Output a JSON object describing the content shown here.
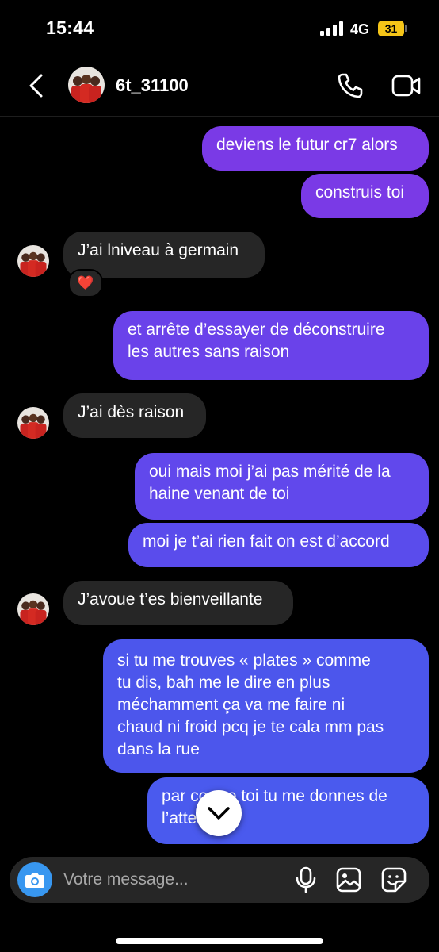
{
  "status_bar": {
    "time": "15:44",
    "network": "4G",
    "battery": "31"
  },
  "header": {
    "username": "6t_31100"
  },
  "messages": [
    {
      "side": "sent",
      "lines": [
        "deviens le futur cr7 alors"
      ]
    },
    {
      "side": "sent",
      "lines": [
        "construis toi"
      ]
    },
    {
      "side": "received",
      "lines": [
        "J’ai lniveau à germain"
      ],
      "reaction": "❤️"
    },
    {
      "side": "sent",
      "lines": [
        "et arrête d’essayer de déconstruire",
        "les autres sans raison"
      ]
    },
    {
      "side": "received",
      "lines": [
        "J’ai dès raison"
      ]
    },
    {
      "side": "sent",
      "lines": [
        "oui mais moi j’ai pas mérité de la",
        "haine venant de toi"
      ]
    },
    {
      "side": "sent",
      "lines": [
        "moi je t’ai rien fait on est d’accord"
      ]
    },
    {
      "side": "received",
      "lines": [
        "J’avoue t’es bienveillante"
      ]
    },
    {
      "side": "sent",
      "lines": [
        "si tu me trouves « plates » comme",
        "tu dis, bah me le dire en plus",
        "méchamment ça va me faire ni",
        "chaud ni froid pcq je te cala mm pas",
        "dans la rue"
      ]
    },
    {
      "side": "sent",
      "lines": [
        "par contre toi tu me donnes de",
        "l’attention"
      ]
    }
  ],
  "composer": {
    "placeholder": "Votre message..."
  },
  "colors": {
    "background": "#000000",
    "received_bubble": "#262626",
    "sent_purple": "#7c3aed",
    "sent_blue": "#4a55e8",
    "camera_button": "#3897f0",
    "battery": "#f5c518"
  },
  "icons": [
    "back-icon",
    "phone-icon",
    "video-icon",
    "camera-icon",
    "microphone-icon",
    "gallery-icon",
    "sticker-icon",
    "chevron-down-icon"
  ]
}
